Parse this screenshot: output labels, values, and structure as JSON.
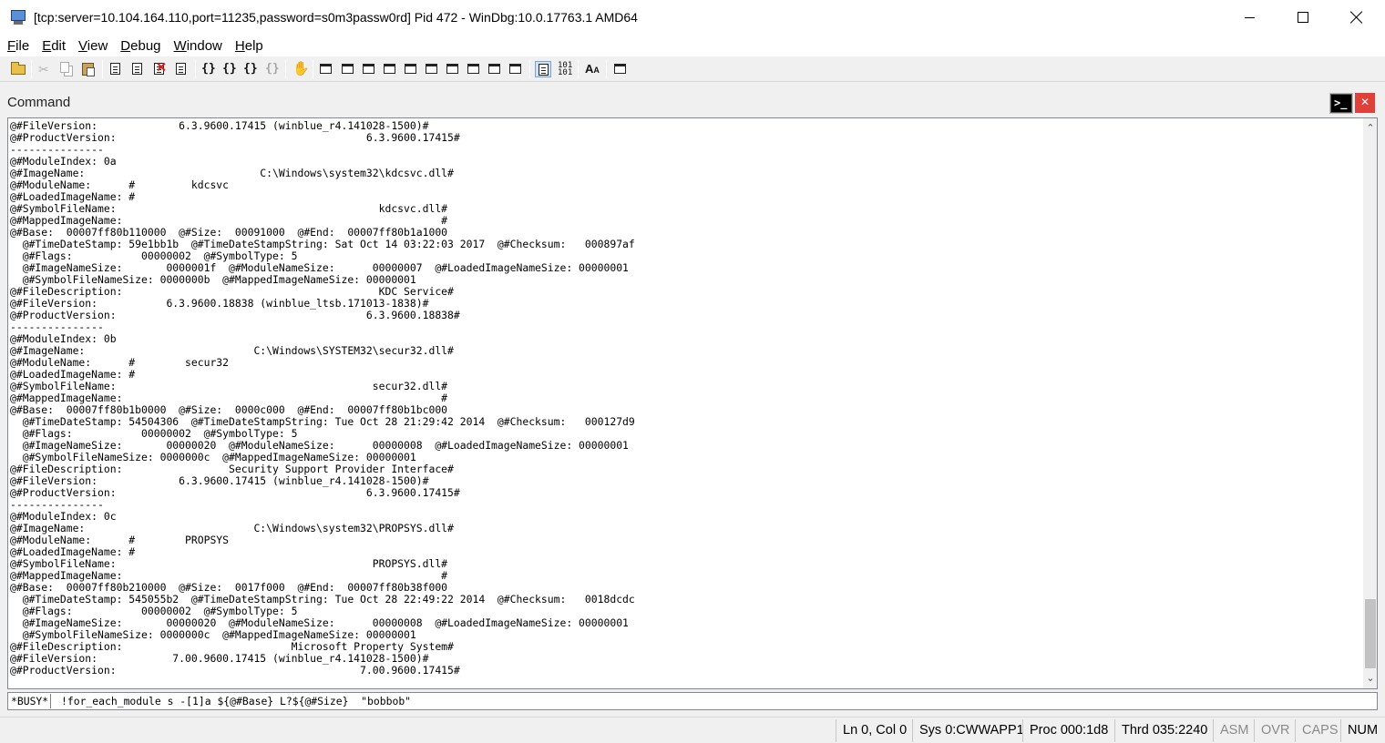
{
  "window": {
    "title": "[tcp:server=10.104.164.110,port=11235,password=s0m3passw0rd] Pid 472 - WinDbg:10.0.17763.1 AMD64"
  },
  "menu": [
    {
      "underline": "F",
      "rest": "ile"
    },
    {
      "underline": "E",
      "rest": "dit"
    },
    {
      "underline": "V",
      "rest": "iew"
    },
    {
      "underline": "D",
      "rest": "ebug"
    },
    {
      "underline": "W",
      "rest": "indow"
    },
    {
      "underline": "H",
      "rest": "elp"
    }
  ],
  "toolbar_icons": [
    "open-folder-icon",
    "cut-icon",
    "copy-icon",
    "paste-icon",
    "go-icon",
    "restart-icon",
    "stop-debugging-icon",
    "break-icon",
    "step-into-icon",
    "step-over-icon",
    "step-out-icon",
    "run-to-cursor-icon",
    "insert-breakpoint-icon",
    "command-window-icon",
    "watch-window-icon",
    "locals-window-icon",
    "registers-window-icon",
    "memory-window-icon",
    "call-stack-window-icon",
    "disassembly-window-icon",
    "scratch-pad-icon",
    "processes-threads-icon",
    "command-browser-icon",
    "source-mode-icon",
    "hex-mode-icon",
    "font-icon",
    "options-icon"
  ],
  "command_window": {
    "title": "Command",
    "output": "@#FileVersion:             6.3.9600.17415 (winblue_r4.141028-1500)#\n@#ProductVersion:                                        6.3.9600.17415#\n---------------\n@#ModuleIndex: 0a\n@#ImageName:                            C:\\Windows\\system32\\kdcsvc.dll#\n@#ModuleName:      #         kdcsvc\n@#LoadedImageName: #\n@#SymbolFileName:                                          kdcsvc.dll#\n@#MappedImageName:                                                   #\n@#Base:  00007ff80b110000  @#Size:  00091000  @#End:  00007ff80b1a1000\n  @#TimeDateStamp: 59e1bb1b  @#TimeDateStampString: Sat Oct 14 03:22:03 2017  @#Checksum:   000897af\n  @#Flags:           00000002  @#SymbolType: 5\n  @#ImageNameSize:       0000001f  @#ModuleNameSize:      00000007  @#LoadedImageNameSize: 00000001\n  @#SymbolFileNameSize: 0000000b  @#MappedImageNameSize: 00000001\n@#FileDescription:                                         KDC Service#\n@#FileVersion:           6.3.9600.18838 (winblue_ltsb.171013-1838)#\n@#ProductVersion:                                        6.3.9600.18838#\n---------------\n@#ModuleIndex: 0b\n@#ImageName:                           C:\\Windows\\SYSTEM32\\secur32.dll#\n@#ModuleName:      #        secur32\n@#LoadedImageName: #\n@#SymbolFileName:                                         secur32.dll#\n@#MappedImageName:                                                   #\n@#Base:  00007ff80b1b0000  @#Size:  0000c000  @#End:  00007ff80b1bc000\n  @#TimeDateStamp: 54504306  @#TimeDateStampString: Tue Oct 28 21:29:42 2014  @#Checksum:   000127d9\n  @#Flags:           00000002  @#SymbolType: 5\n  @#ImageNameSize:       00000020  @#ModuleNameSize:      00000008  @#LoadedImageNameSize: 00000001\n  @#SymbolFileNameSize: 0000000c  @#MappedImageNameSize: 00000001\n@#FileDescription:                 Security Support Provider Interface#\n@#FileVersion:             6.3.9600.17415 (winblue_r4.141028-1500)#\n@#ProductVersion:                                        6.3.9600.17415#\n---------------\n@#ModuleIndex: 0c\n@#ImageName:                           C:\\Windows\\system32\\PROPSYS.dll#\n@#ModuleName:      #        PROPSYS\n@#LoadedImageName: #\n@#SymbolFileName:                                         PROPSYS.dll#\n@#MappedImageName:                                                   #\n@#Base:  00007ff80b210000  @#Size:  0017f000  @#End:  00007ff80b38f000\n  @#TimeDateStamp: 545055b2  @#TimeDateStampString: Tue Oct 28 22:49:22 2014  @#Checksum:   0018dcdc\n  @#Flags:           00000002  @#SymbolType: 5\n  @#ImageNameSize:       00000020  @#ModuleNameSize:      00000008  @#LoadedImageNameSize: 00000001\n  @#SymbolFileNameSize: 0000000c  @#MappedImageNameSize: 00000001\n@#FileDescription:                           Microsoft Property System#\n@#FileVersion:            7.00.9600.17415 (winblue_r4.141028-1500)#\n@#ProductVersion:                                       7.00.9600.17415#",
    "prompt_label": "*BUSY*",
    "command_text": "!for_each_module s -[1]a ${@#Base} L?${@#Size}  \"bobbob\""
  },
  "status_bar": {
    "position": "Ln 0, Col 0",
    "sys": "Sys 0:CWWAPP1",
    "proc": "Proc 000:1d8",
    "thrd": "Thrd 035:2240",
    "asm": "ASM",
    "ovr": "OVR",
    "caps": "CAPS",
    "num": "NUM"
  }
}
